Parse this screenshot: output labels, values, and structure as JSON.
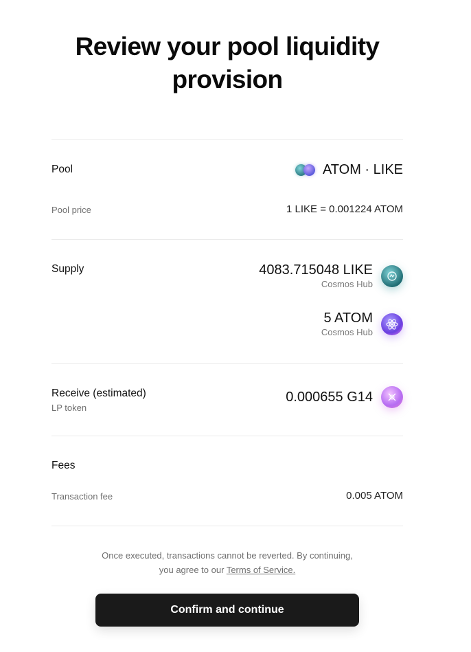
{
  "title": {
    "line1": "Review your pool liquidity",
    "line2": "provision"
  },
  "pool": {
    "label": "Pool",
    "pair": "ATOM · LIKE",
    "icons": [
      "like-token-icon",
      "atom-token-icon"
    ],
    "price_label": "Pool price",
    "price_value": "1 LIKE = 0.001224 ATOM"
  },
  "supply": {
    "label": "Supply",
    "items": [
      {
        "amount": "4083.715048 LIKE",
        "chain": "Cosmos Hub",
        "icon": "like-token-icon"
      },
      {
        "amount": "5 ATOM",
        "chain": "Cosmos Hub",
        "icon": "atom-token-icon"
      }
    ]
  },
  "receive": {
    "label": "Receive (estimated)",
    "sublabel": "LP token",
    "amount": "0.000655 G14",
    "icon": "lp-token-icon"
  },
  "fees": {
    "label": "Fees",
    "tx_label": "Transaction fee",
    "tx_value": "0.005 ATOM"
  },
  "notice": {
    "line1": "Once executed, transactions cannot be reverted. By continuing,",
    "line2_prefix": "you agree to our ",
    "terms_link": "Terms of Service."
  },
  "confirm_label": "Confirm and continue",
  "colors": {
    "button_bg": "#1a1a1a",
    "divider": "#ebebeb",
    "muted_text": "#6f6f6f"
  }
}
